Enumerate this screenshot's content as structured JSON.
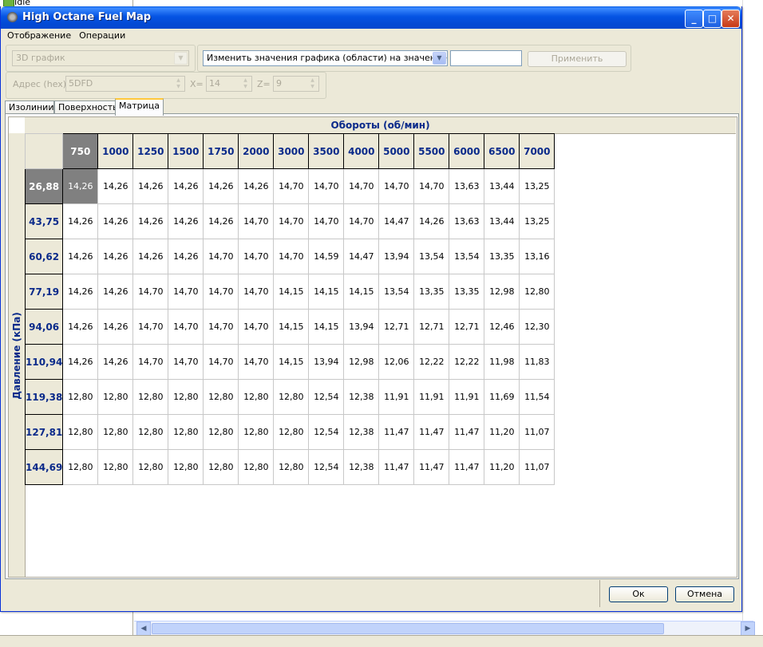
{
  "background": {
    "tree_item_label": "Idle"
  },
  "window": {
    "title": "High Octane Fuel Map"
  },
  "menu": [
    "Отображение",
    "Операции"
  ],
  "toolbar": {
    "view_combo": "3D график",
    "operation_combo": "Изменить значения графика (области) на значение",
    "value_input": "",
    "apply_label": "Применить",
    "address_label": "Адрес (hex)",
    "address_value": "5DFD",
    "x_label": "X=",
    "x_value": "14",
    "z_label": "Z=",
    "z_value": "9"
  },
  "tabs": [
    "Изолинии",
    "Поверхность",
    "Матрица"
  ],
  "active_tab": 2,
  "matrix": {
    "col_axis_label": "Обороты (об/мин)",
    "row_axis_label": "Давление (кПа)",
    "columns": [
      "750",
      "1000",
      "1250",
      "1500",
      "1750",
      "2000",
      "3000",
      "3500",
      "4000",
      "5000",
      "5500",
      "6000",
      "6500",
      "7000"
    ],
    "rows": [
      {
        "label": "26,88",
        "values": [
          "14,26",
          "14,26",
          "14,26",
          "14,26",
          "14,26",
          "14,26",
          "14,70",
          "14,70",
          "14,70",
          "14,70",
          "14,70",
          "13,63",
          "13,44",
          "13,25"
        ]
      },
      {
        "label": "43,75",
        "values": [
          "14,26",
          "14,26",
          "14,26",
          "14,26",
          "14,26",
          "14,70",
          "14,70",
          "14,70",
          "14,70",
          "14,47",
          "14,26",
          "13,63",
          "13,44",
          "13,25"
        ]
      },
      {
        "label": "60,62",
        "values": [
          "14,26",
          "14,26",
          "14,26",
          "14,26",
          "14,70",
          "14,70",
          "14,70",
          "14,59",
          "14,47",
          "13,94",
          "13,54",
          "13,54",
          "13,35",
          "13,16"
        ]
      },
      {
        "label": "77,19",
        "values": [
          "14,26",
          "14,26",
          "14,70",
          "14,70",
          "14,70",
          "14,70",
          "14,15",
          "14,15",
          "14,15",
          "13,54",
          "13,35",
          "13,35",
          "12,98",
          "12,80"
        ]
      },
      {
        "label": "94,06",
        "values": [
          "14,26",
          "14,26",
          "14,70",
          "14,70",
          "14,70",
          "14,70",
          "14,15",
          "14,15",
          "13,94",
          "12,71",
          "12,71",
          "12,71",
          "12,46",
          "12,30"
        ]
      },
      {
        "label": "110,94",
        "values": [
          "14,26",
          "14,26",
          "14,70",
          "14,70",
          "14,70",
          "14,70",
          "14,15",
          "13,94",
          "12,98",
          "12,06",
          "12,22",
          "12,22",
          "11,98",
          "11,83"
        ]
      },
      {
        "label": "119,38",
        "values": [
          "12,80",
          "12,80",
          "12,80",
          "12,80",
          "12,80",
          "12,80",
          "12,80",
          "12,54",
          "12,38",
          "11,91",
          "11,91",
          "11,91",
          "11,69",
          "11,54"
        ]
      },
      {
        "label": "127,81",
        "values": [
          "12,80",
          "12,80",
          "12,80",
          "12,80",
          "12,80",
          "12,80",
          "12,80",
          "12,54",
          "12,38",
          "11,47",
          "11,47",
          "11,47",
          "11,20",
          "11,07"
        ]
      },
      {
        "label": "144,69",
        "values": [
          "12,80",
          "12,80",
          "12,80",
          "12,80",
          "12,80",
          "12,80",
          "12,80",
          "12,54",
          "12,38",
          "11,47",
          "11,47",
          "11,47",
          "11,20",
          "11,07"
        ]
      }
    ]
  },
  "footer": {
    "ok_label": "Ок",
    "cancel_label": "Отмена"
  }
}
